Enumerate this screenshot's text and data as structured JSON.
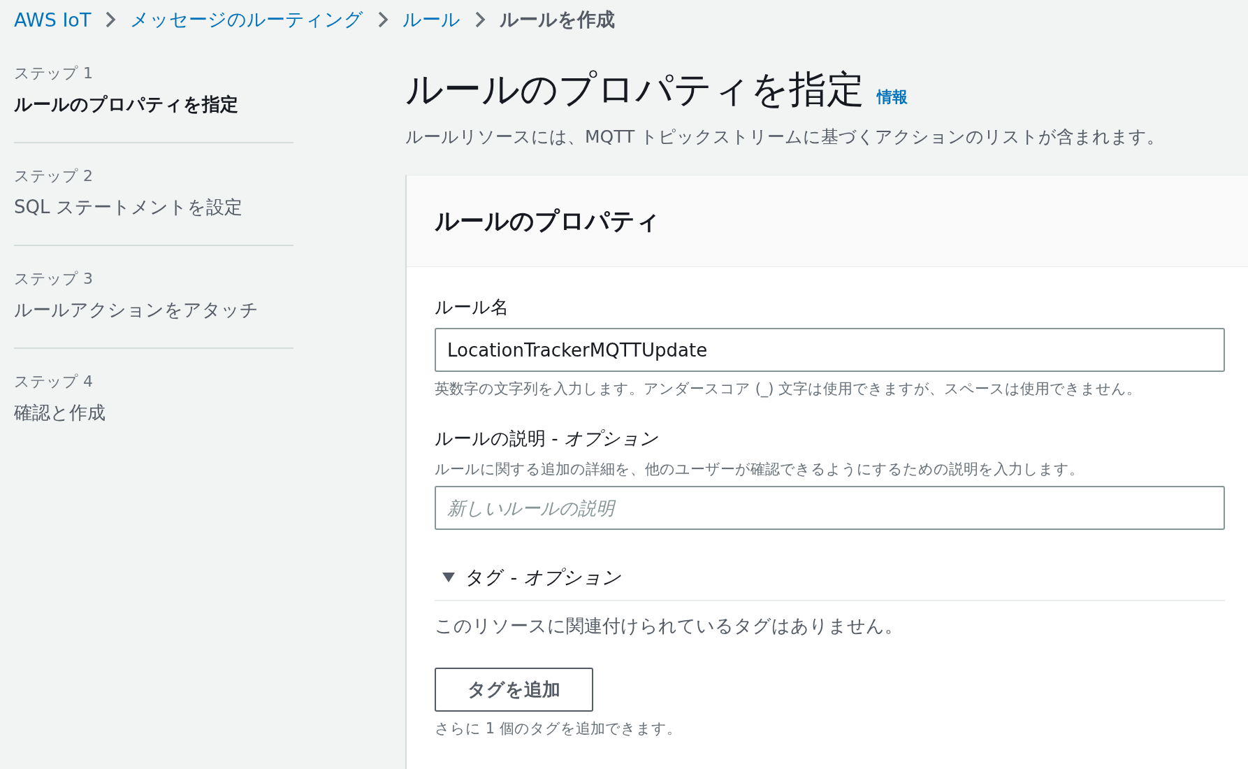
{
  "breadcrumb": [
    {
      "text": "AWS IoT",
      "kind": "link"
    },
    {
      "text": "メッセージのルーティング",
      "kind": "link"
    },
    {
      "text": "ルール",
      "kind": "link"
    },
    {
      "text": "ルールを作成",
      "kind": "current"
    }
  ],
  "steps": [
    {
      "label": "ステップ 1",
      "title": "ルールのプロパティを指定",
      "selected": true
    },
    {
      "label": "ステップ 2",
      "title": "SQL ステートメントを設定",
      "selected": false
    },
    {
      "label": "ステップ 3",
      "title": "ルールアクションをアタッチ",
      "selected": false
    },
    {
      "label": "ステップ 4",
      "title": "確認と作成",
      "selected": false
    }
  ],
  "page": {
    "title": "ルールのプロパティを指定",
    "info_link": "情報",
    "description": "ルールリソースには、MQTT トピックストリームに基づくアクションのリストが含まれます。"
  },
  "panel": {
    "title": "ルールのプロパティ",
    "name_field": {
      "label": "ルール名",
      "value": "LocationTrackerMQTTUpdate",
      "hint": "英数字の文字列を入力します。アンダースコア (_) 文字は使用できますが、スペースは使用できません。"
    },
    "description_field": {
      "label": "ルールの説明 - *オプション*",
      "hint": "ルールに関する追加の詳細を、他のユーザーが確認できるようにするための説明を入力します。",
      "placeholder": "新しいルールの説明"
    },
    "tags": {
      "title": "タグ - *オプション*",
      "expanded": true,
      "empty_text": "このリソースに関連付けられているタグはありません。",
      "add_button": "タグを追加",
      "limit_text": "さらに 1 個のタグを追加できます。"
    }
  }
}
